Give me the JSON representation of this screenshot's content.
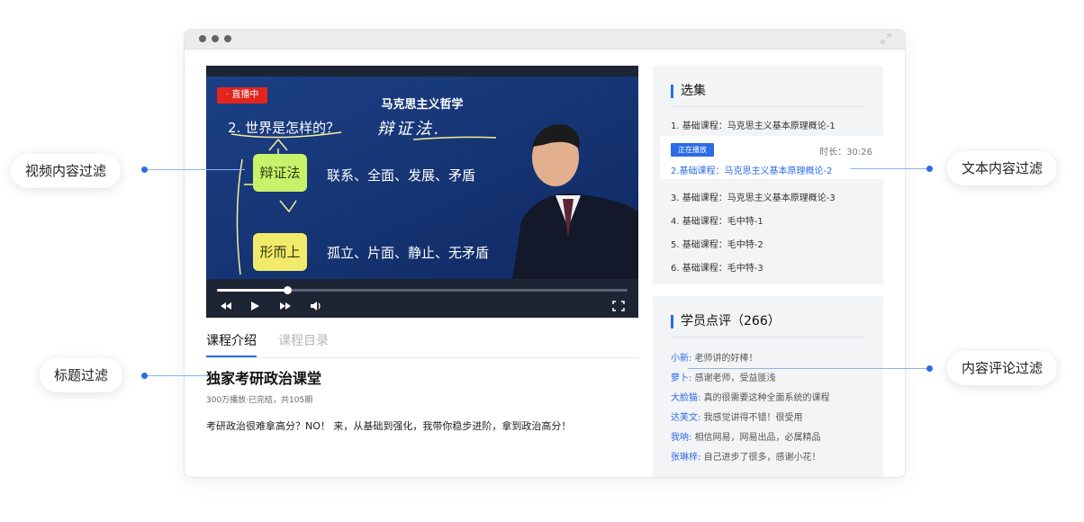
{
  "player": {
    "live_badge": "· 直播中",
    "slide_title": "马克思主义哲学",
    "slide_question": "2. 世界是怎样的？",
    "slide_chalk": "辩证法.",
    "box1_label": "辩证法",
    "box1_text": "联系、全面、发展、矛盾",
    "box2_label": "形而上",
    "box2_text": "孤立、片面、静止、无矛盾",
    "progress": 0.17
  },
  "tabs": [
    {
      "label": "课程介绍",
      "active": true
    },
    {
      "label": "课程目录",
      "active": false
    }
  ],
  "course": {
    "title": "独家考研政治课堂",
    "meta": "300万播放·已完结，共105期",
    "description": "考研政治很难拿高分？NO！ 来，从基础到强化，我带你稳步进阶，拿到政治高分！"
  },
  "episodes": {
    "heading": "选集",
    "items": [
      {
        "label": "1. 基础课程：马克思主义基本原理概论-1"
      },
      {
        "label": "3. 基础课程：马克思主义基本原理概论-3"
      },
      {
        "label": "4. 基础课程：毛中特-1"
      },
      {
        "label": "5. 基础课程：毛中特-2"
      },
      {
        "label": "6. 基础课程：毛中特-3"
      }
    ],
    "current": {
      "tag": "正在播放",
      "duration": "时长：30:26",
      "label": "2.基础课程：马克思主义基本原理概论-2"
    }
  },
  "comments": {
    "heading": "学员点评（266）",
    "items": [
      {
        "name": "小新:",
        "text": "老师讲的好棒！"
      },
      {
        "name": "萝卜:",
        "text": "感谢老师，受益匪浅"
      },
      {
        "name": "大脸猫:",
        "text": "真的很需要这种全面系统的课程"
      },
      {
        "name": "达芙文:",
        "text": "我感觉讲得不错！很受用"
      },
      {
        "name": "我呐:",
        "text": "相信网易，网易出品，必属精品"
      },
      {
        "name": "张琳梓:",
        "text": "自己进步了很多，感谢小花！"
      }
    ]
  },
  "callouts": {
    "video": "视频内容过滤",
    "title": "标题过滤",
    "text": "文本内容过滤",
    "comment": "内容评论过滤"
  },
  "colors": {
    "accent": "#2b6be6",
    "live": "#e3261d",
    "panel": "#f2f4f6"
  }
}
